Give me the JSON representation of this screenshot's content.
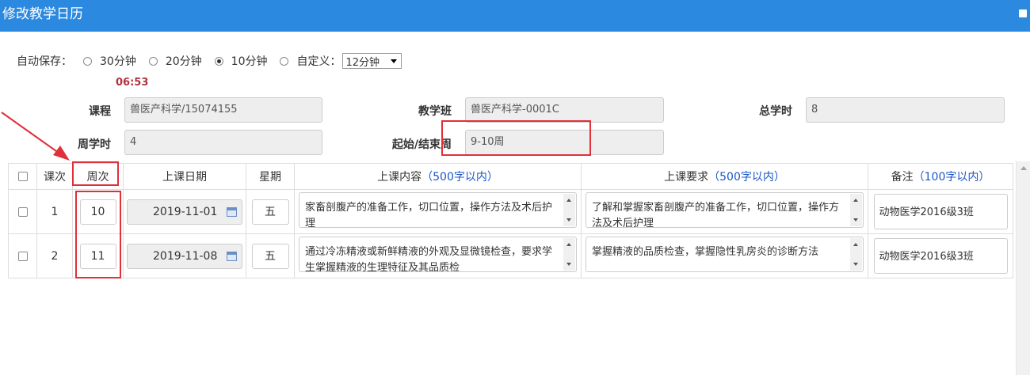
{
  "window": {
    "title": "修改教学日历"
  },
  "autosave": {
    "label": "自动保存：",
    "options": [
      "30分钟",
      "20分钟",
      "10分钟",
      "自定义："
    ],
    "selected_index": 2,
    "custom_select_value": "12分钟",
    "countdown": "06:53"
  },
  "form": {
    "course_label": "课程",
    "course_value": "兽医产科学/15074155",
    "class_label": "教学班",
    "class_value": "兽医产科学-0001C",
    "total_hours_label": "总学时",
    "total_hours_value": "8",
    "weekly_hours_label": "周学时",
    "weekly_hours_value": "4",
    "period_label": "起始/结束周",
    "period_value": "9-10周"
  },
  "table": {
    "headers": {
      "lesson": "课次",
      "week": "周次",
      "date": "上课日期",
      "weekday": "星期",
      "content": "上课内容",
      "content_hint": "（500字以内）",
      "requirement": "上课要求",
      "requirement_hint": "（500字以内）",
      "note": "备注",
      "note_hint": "（100字以内）"
    },
    "rows": [
      {
        "lesson": "1",
        "week": "10",
        "date": "2019-11-01",
        "weekday": "五",
        "content": "家畜剖腹产的准备工作，切口位置，操作方法及术后护理",
        "requirement": "了解和掌握家畜剖腹产的准备工作，切口位置，操作方法及术后护理",
        "note": "动物医学2016级3班"
      },
      {
        "lesson": "2",
        "week": "11",
        "date": "2019-11-08",
        "weekday": "五",
        "content": "通过冷冻精液或新鲜精液的外观及显微镜检查，要求学生掌握精液的生理特征及其品质检",
        "requirement": "掌握精液的品质检查，掌握隐性乳房炎的诊断方法",
        "note": "动物医学2016级3班"
      }
    ]
  },
  "colors": {
    "titlebar": "#2b89e0",
    "countdown": "#b0313d",
    "annotation": "#e0303a",
    "hint": "#1a56c9"
  }
}
